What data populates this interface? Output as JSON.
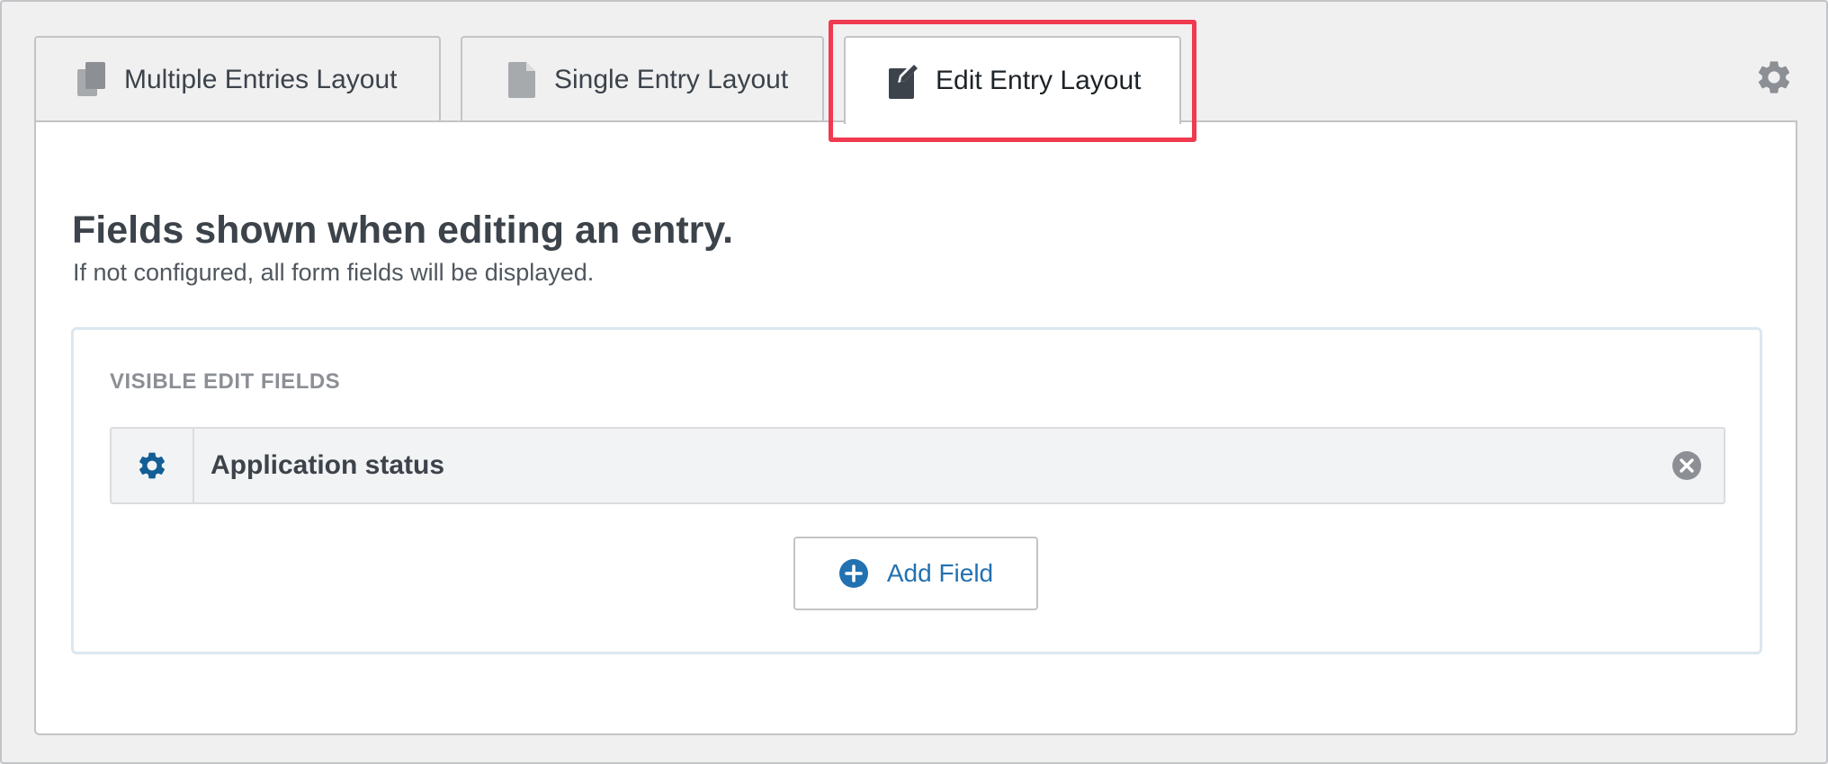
{
  "tabs": [
    {
      "label": "Multiple Entries Layout",
      "icon": "documents-icon",
      "active": false
    },
    {
      "label": "Single Entry Layout",
      "icon": "document-icon",
      "active": false
    },
    {
      "label": "Edit Entry Layout",
      "icon": "edit-document-icon",
      "active": true
    }
  ],
  "settings_icon": "gear-icon",
  "panel": {
    "title": "Fields shown when editing an entry.",
    "subtitle": "If not configured, all form fields will be displayed.",
    "section_label": "VISIBLE EDIT FIELDS",
    "fields": [
      {
        "label": "Application status"
      }
    ],
    "add_field_label": "Add Field"
  },
  "colors": {
    "accent": "#2271b1",
    "highlight": "#ef3a4f",
    "field_gear": "#135e96"
  }
}
